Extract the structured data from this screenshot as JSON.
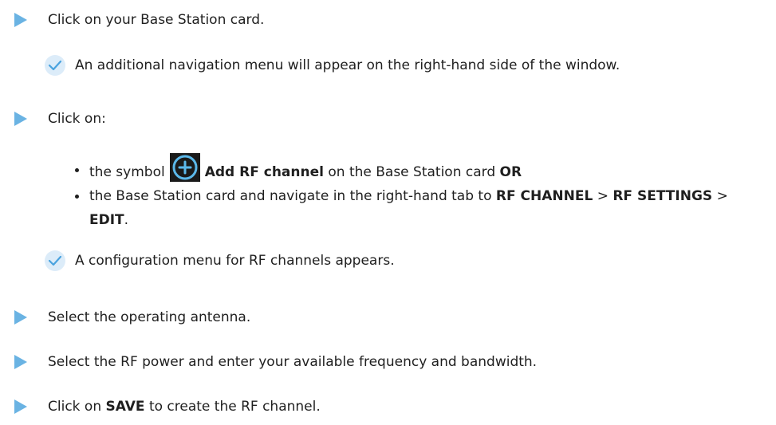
{
  "steps": {
    "s1": "Click on your Base Station card.",
    "r1": "An additional navigation menu will appear on the right-hand side of the window.",
    "s2": "Click on:",
    "b1_pre": "the symbol",
    "b1_bold": "Add RF channel",
    "b1_mid": "on the Base Station card",
    "b1_or": "OR",
    "b2_pre": "the Base Station card and navigate in the right-hand tab to",
    "b2_rfc": "RF CHANNEL",
    "b2_gt1": ">",
    "b2_rfs": "RF SETTINGS",
    "b2_gt2": ">",
    "b2_edit": "EDIT",
    "b2_end": ".",
    "r2": "A configuration menu for RF channels appears.",
    "s3": "Select the operating antenna.",
    "s4": "Select the RF power and enter your available frequency and bandwidth.",
    "s5_pre": "Click on",
    "s5_bold": "SAVE",
    "s5_post": "to create the RF channel."
  },
  "colors": {
    "arrow": "#6ab3e3",
    "check_bg": "#dcecf9",
    "check_mark": "#4aa3df",
    "plus_circle": "#5bb8ea"
  }
}
